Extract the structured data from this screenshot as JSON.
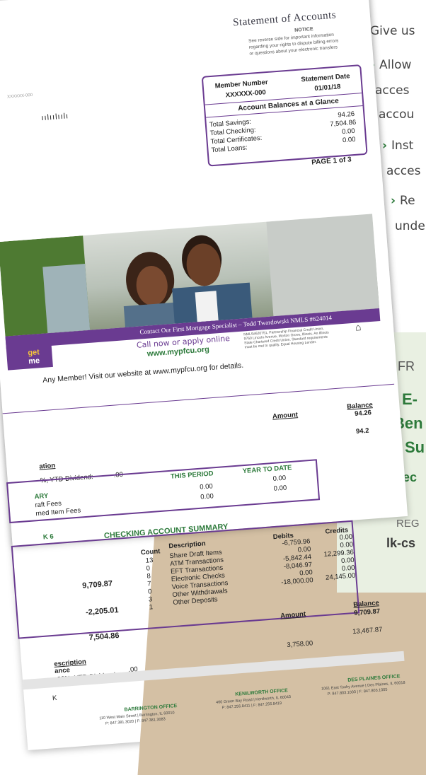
{
  "right_panel": {
    "intro": "Give us",
    "bullets": [
      "Allow",
      "acces",
      "accou",
      "Inst",
      "acces",
      "Re",
      "unde"
    ],
    "card": {
      "line1": "FR",
      "line2": "E-",
      "line3": "Ben",
      "line4": "Su",
      "link": "Dec",
      "reg_label": "REG",
      "reg_value": "lk-cs"
    }
  },
  "statement": {
    "title": "Statement of Accounts",
    "notice_title": "NOTICE",
    "notice_body": [
      "See reverse side for important information",
      "regarding your rights to dispute billing errors",
      "or questions about your electronic transfers"
    ],
    "account_id": "XXXXXX-000",
    "member_number_label": "Member Number",
    "member_number": "XXXXXX-000",
    "statement_date_label": "Statement Date",
    "statement_date": "01/01/18",
    "balances_title": "Account Balances at a Glance",
    "balances": [
      {
        "label": "Total Savings:",
        "value": "94.26"
      },
      {
        "label": "Total Checking:",
        "value": "7,504.86"
      },
      {
        "label": "Total Certificates:",
        "value": "0.00"
      },
      {
        "label": "Total Loans:",
        "value": "0.00"
      }
    ],
    "page": "PAGE 1 of 3",
    "barcode": "ıılıılıılı",
    "mortgage_banner": "Contact Our First Mortgage Specialist – Todd Twardowski NMLS #624014",
    "call_text": "Call now or apply online",
    "site": "www.mypfcu.org",
    "badge_line1": "get",
    "badge_line2": "me",
    "fine_print": [
      "NMLS#620751, Partnership Financial Credit Union,",
      "9760 Lincoln Avenue, Morton Grove, Illinois. An Illinois",
      "State Chartered Credit Union. Standard requirements",
      "must be met to qualify. Equal Housing Lender."
    ],
    "promo": "Any Member!  Visit our website at www.mypfcu.org for details.",
    "savings": {
      "amount_header": "Amount",
      "balance_header": "Balance",
      "balance_start": "94.26",
      "balance_end": "94.2",
      "desc_header": "ation",
      "dividend": "%, YTD Dividend:",
      "dividend_value": ".00"
    },
    "summary": {
      "col_this": "THIS PERIOD",
      "col_ytd": "YEAR TO DATE",
      "title": "ARY",
      "rows": [
        {
          "label": "raft Fees",
          "this": "0.00",
          "ytd": "0.00"
        },
        {
          "label": "rned Item Fees",
          "this": "0.00",
          "ytd": "0.00"
        }
      ]
    },
    "checking": {
      "section": "K 6",
      "title": "CHECKING ACCOUNT SUMMARY",
      "col_count": "Count",
      "col_desc": "Description",
      "col_debits": "Debits",
      "col_credits": "Credits",
      "left_values": [
        "9,709.87",
        "-2,205.01",
        "7,504.86"
      ],
      "rows": [
        {
          "count": "13",
          "desc": "Share Draft Items",
          "debit": "-6,759.96",
          "credit": "0.00"
        },
        {
          "count": "0",
          "desc": "ATM Transactions",
          "debit": "0.00",
          "credit": "0.00"
        },
        {
          "count": "8",
          "desc": "EFT Transactions",
          "debit": "-5,842.44",
          "credit": "12,299.36"
        },
        {
          "count": "7",
          "desc": "Electronic Checks",
          "debit": "-8,046.97",
          "credit": "0.00"
        },
        {
          "count": "0",
          "desc": "Voice Transactions",
          "debit": "0.00",
          "credit": "0.00"
        },
        {
          "count": "3",
          "desc": "Other Withdrawals",
          "debit": "-18,000.00",
          "credit": ""
        },
        {
          "count": "1",
          "desc": "Other Deposits",
          "debit": "",
          "credit": "24,145.00"
        }
      ],
      "amount_header": "Amount",
      "balance_header": "Balance",
      "balance_start": "9,709.87",
      "desc_header": "escription",
      "row_amount": "3,758.00",
      "row_balance": "13,467.87",
      "ance": "ance",
      "dividend": ".00%, YTD Dividend:",
      "dividend_value": ".00",
      "k": "K"
    },
    "offices": [
      {
        "name": "BARRINGTON OFFICE",
        "addr": "110 West Main Street | Barrington, IL 60010",
        "phone": "P: 847.381.3020 | F: 847.381.3083"
      },
      {
        "name": "KENILWORTH OFFICE",
        "addr": "460 Green Bay Road | Kenilworth, IL 60043",
        "phone": "P: 847.256.8411 | F: 847.256.8419"
      },
      {
        "name": "DES PLAINES OFFICE",
        "addr": "1061 East Touhy Avenue | Des Plaines, IL 60018",
        "phone": "P: 847.803.1003 | F: 847.803.1005"
      }
    ]
  }
}
